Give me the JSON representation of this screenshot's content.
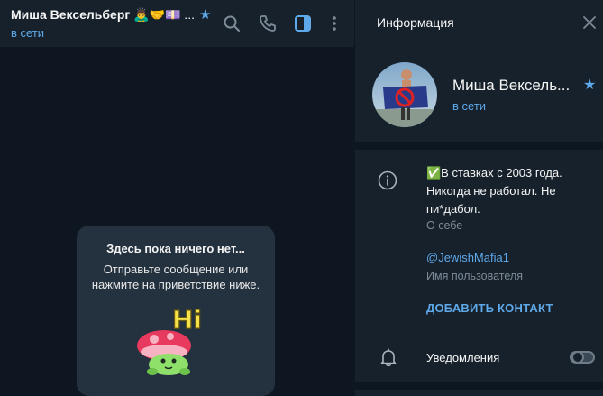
{
  "colors": {
    "background": "#0e1621",
    "panel": "#17212b",
    "card": "#243240",
    "accent": "#5ea9ea",
    "muted_text": "#7f8b97",
    "primary_text": "#f5f5f5"
  },
  "chat_header": {
    "title": "Миша Вексельберг",
    "title_emoji": "🙇‍♂️🤝💷 ...",
    "star_icon": "★",
    "status": "в сети",
    "icons": [
      "search-icon",
      "phone-icon",
      "sidebar-toggle-icon",
      "more-vertical-icon"
    ]
  },
  "empty_chat": {
    "title": "Здесь пока ничего нет...",
    "subtitle_line1": "Отправьте сообщение или",
    "subtitle_line2": "нажмите на приветствие ниже.",
    "sticker_text": "Hi"
  },
  "info_panel": {
    "header_title": "Информация",
    "close_icon": "close-icon",
    "profile_name": "Миша Вексель...",
    "star_icon": "★",
    "profile_status": "в сети",
    "bio_line1": "✅В ставках с 2003 года.",
    "bio_line2": "Никогда не работал. Не",
    "bio_line3": "пи*дабол.",
    "bio_label": "О себе",
    "username": "@JewishMafia1",
    "username_label": "Имя пользователя",
    "add_contact": "ДОБАВИТЬ КОНТАКТ",
    "notifications_label": "Уведомления",
    "notifications_enabled": false
  }
}
